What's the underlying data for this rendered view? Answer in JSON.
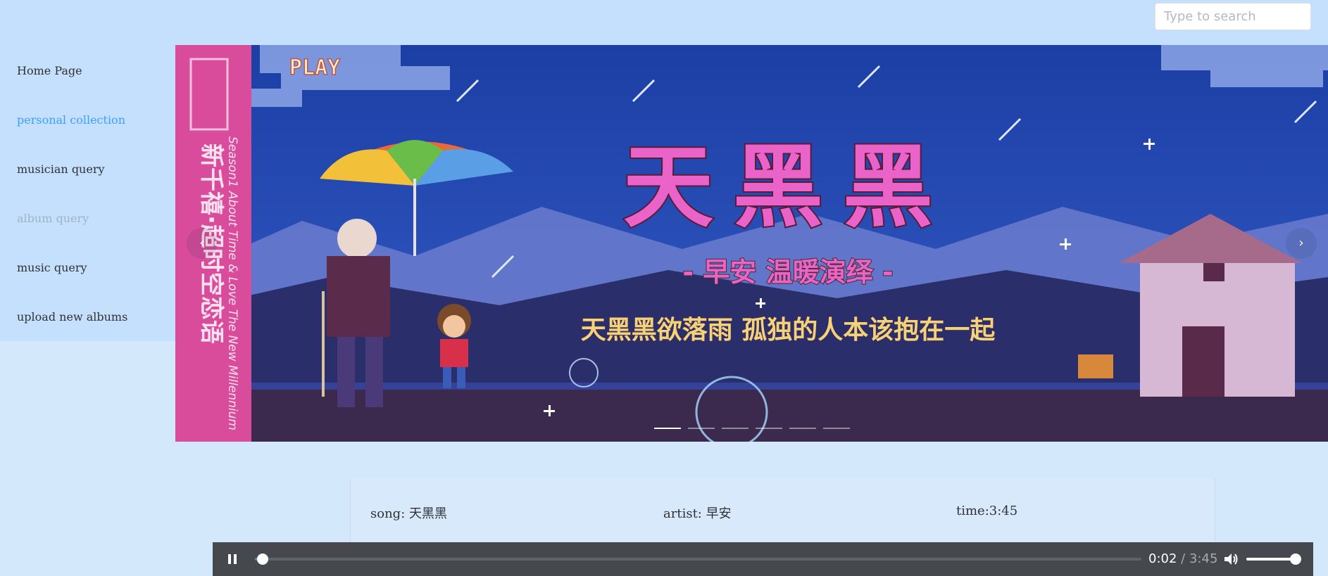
{
  "search": {
    "placeholder": "Type to search"
  },
  "sidebar": {
    "items": [
      {
        "label": "Home Page",
        "state": "normal"
      },
      {
        "label": "personal collection",
        "state": "active"
      },
      {
        "label": "musician query",
        "state": "normal"
      },
      {
        "label": "album query",
        "state": "disabled"
      },
      {
        "label": "music query",
        "state": "normal"
      },
      {
        "label": "upload new albums",
        "state": "normal"
      }
    ]
  },
  "carousel": {
    "banner": {
      "play_label": "PLAY",
      "title": "天黑黑",
      "subtitle": "- 早安 温暖演绎 -",
      "lyric": "天黑黑欲落雨 孤独的人本该抱在一起",
      "album_title": "新千禧·超时空恋语",
      "album_tagline": "Season1 About Time & Love The New Millennium"
    },
    "prev_icon": "chevron-left-icon",
    "next_icon": "chevron-right-icon",
    "slide_count": 6,
    "active_index": 0
  },
  "song_info": {
    "song": "song: 天黑黑",
    "artist": "artist: 早安",
    "time": "time:3:45"
  },
  "player": {
    "state": "playing",
    "current": "0:02",
    "separator": "/",
    "duration": "3:45",
    "progress": 0.009,
    "volume": 1.0,
    "play_icon": "pause-icon",
    "volume_icon": "volume-icon",
    "accent_color": "#3e8ed0"
  },
  "colors": {
    "page_bg": "#d4e8fc",
    "sidebar_bg": "#c4e0fd",
    "active_link": "#409eff",
    "player_bg": "#45484d"
  }
}
